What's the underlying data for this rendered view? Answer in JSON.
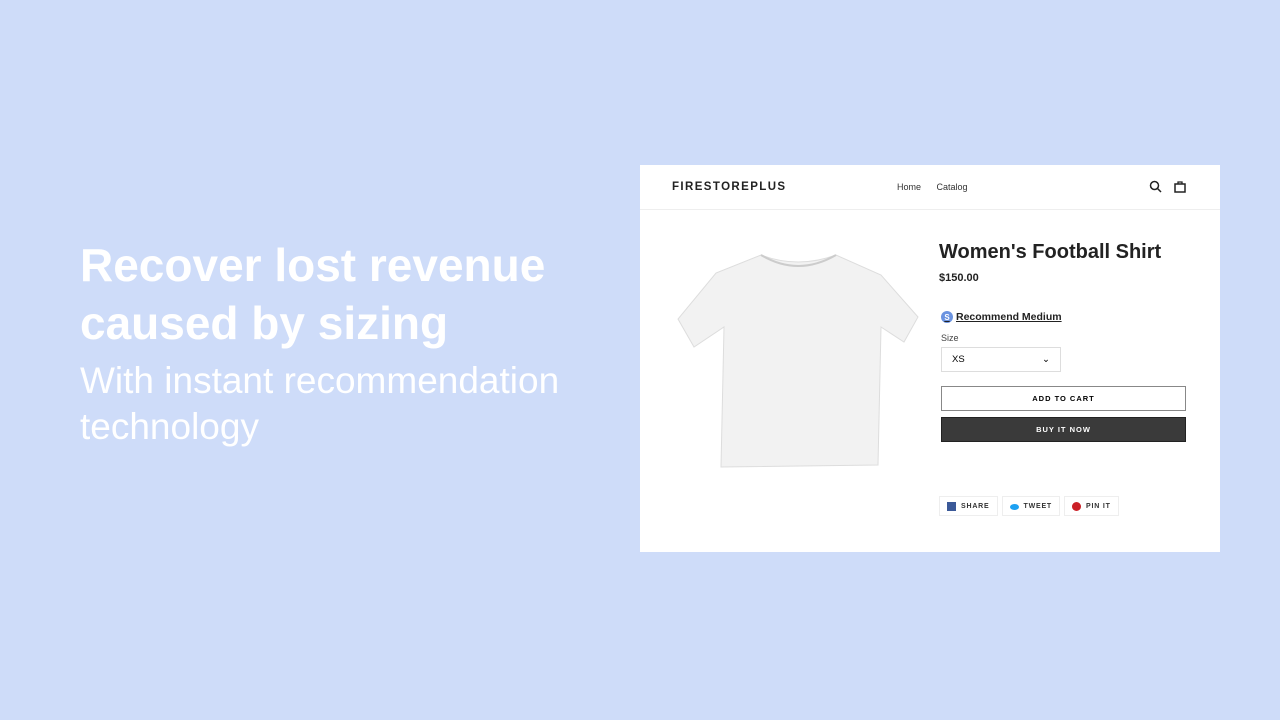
{
  "hero": {
    "headline": "Recover lost revenue caused by sizing",
    "subheadline": "With instant recommendation technology"
  },
  "store": {
    "logo": "FIRESTOREPLUS",
    "nav": [
      "Home",
      "Catalog"
    ],
    "icons": [
      "search-icon",
      "cart-icon"
    ]
  },
  "product": {
    "title": "Women's Football Shirt",
    "price": "$150.00",
    "recommendation": "Recommend Medium",
    "recommend_badge": "S",
    "size_label": "Size",
    "size_value": "XS",
    "add_to_cart": "ADD TO CART",
    "buy_now": "BUY IT NOW",
    "share": [
      {
        "label": "SHARE",
        "color": "#3b5998"
      },
      {
        "label": "TWEET",
        "color": "#1da1f2"
      },
      {
        "label": "PIN IT",
        "color": "#cb2027"
      }
    ]
  }
}
